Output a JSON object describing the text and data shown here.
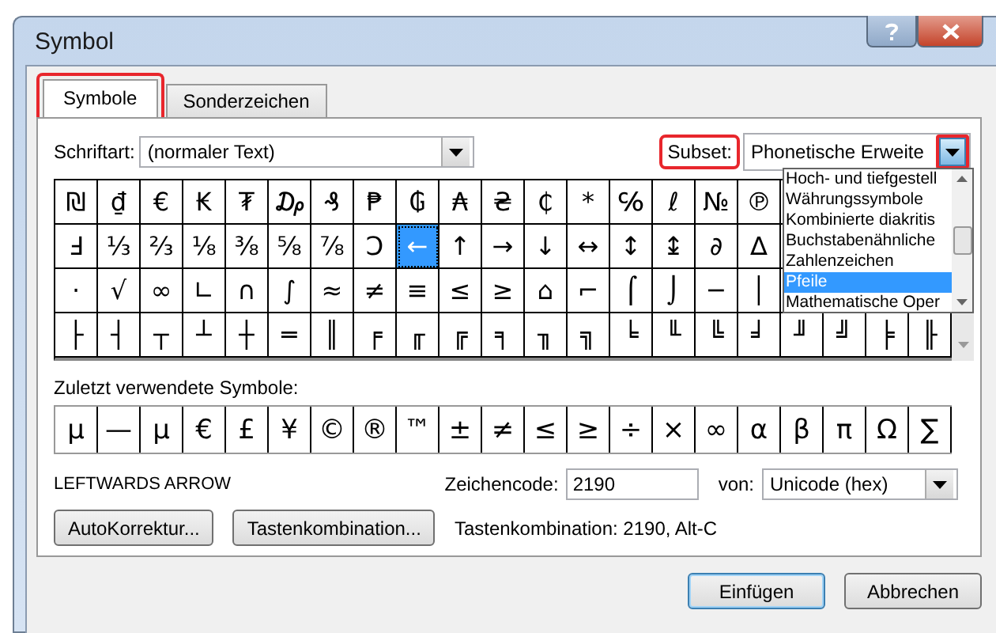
{
  "window": {
    "title": "Symbol"
  },
  "tabs": [
    {
      "label": "Symbole",
      "selected": true,
      "highlighted": true
    },
    {
      "label": "Sonderzeichen",
      "selected": false,
      "highlighted": false
    }
  ],
  "font": {
    "label": "Schriftart:",
    "value": "(normaler Text)"
  },
  "subset": {
    "label": "Subset:",
    "label_highlighted": true,
    "value": "Phonetische Erweite",
    "arrow_highlighted": true,
    "expanded": true,
    "options": [
      {
        "label": "Hoch- und tiefgestell",
        "selected": false
      },
      {
        "label": "Währungssymbole",
        "selected": false
      },
      {
        "label": "Kombinierte diakritis",
        "selected": false
      },
      {
        "label": "Buchstabenähnliche",
        "selected": false
      },
      {
        "label": "Zahlenzeichen",
        "selected": false
      },
      {
        "label": "Pfeile",
        "selected": true
      },
      {
        "label": "Mathematische Oper",
        "selected": false
      }
    ]
  },
  "symbol_grid": {
    "rows": [
      [
        {
          "symbol": "₪",
          "selected": false
        },
        {
          "symbol": "₫",
          "selected": false
        },
        {
          "symbol": "€",
          "selected": false
        },
        {
          "symbol": "₭",
          "selected": false
        },
        {
          "symbol": "₮",
          "selected": false
        },
        {
          "symbol": "₯",
          "selected": false
        },
        {
          "symbol": "₰",
          "selected": false
        },
        {
          "symbol": "₱",
          "selected": false
        },
        {
          "symbol": "₲",
          "selected": false
        },
        {
          "symbol": "₳",
          "selected": false
        },
        {
          "symbol": "₴",
          "selected": false
        },
        {
          "symbol": "₵",
          "selected": false
        },
        {
          "symbol": "*",
          "selected": false
        },
        {
          "symbol": "℅",
          "selected": false
        },
        {
          "symbol": "ℓ",
          "selected": false
        },
        {
          "symbol": "№",
          "selected": false
        },
        {
          "symbol": "℗",
          "selected": false
        }
      ],
      [
        {
          "symbol": "Ⅎ",
          "selected": false
        },
        {
          "symbol": "⅓",
          "selected": false
        },
        {
          "symbol": "⅔",
          "selected": false
        },
        {
          "symbol": "⅛",
          "selected": false
        },
        {
          "symbol": "⅜",
          "selected": false
        },
        {
          "symbol": "⅝",
          "selected": false
        },
        {
          "symbol": "⅞",
          "selected": false
        },
        {
          "symbol": "Ↄ",
          "selected": false
        },
        {
          "symbol": "←",
          "selected": true
        },
        {
          "symbol": "↑",
          "selected": false
        },
        {
          "symbol": "→",
          "selected": false
        },
        {
          "symbol": "↓",
          "selected": false
        },
        {
          "symbol": "↔",
          "selected": false
        },
        {
          "symbol": "↕",
          "selected": false
        },
        {
          "symbol": "↨",
          "selected": false
        },
        {
          "symbol": "∂",
          "selected": false
        },
        {
          "symbol": "∆",
          "selected": false
        }
      ],
      [
        {
          "symbol": "·",
          "selected": false
        },
        {
          "symbol": "√",
          "selected": false
        },
        {
          "symbol": "∞",
          "selected": false
        },
        {
          "symbol": "∟",
          "selected": false
        },
        {
          "symbol": "∩",
          "selected": false
        },
        {
          "symbol": "∫",
          "selected": false
        },
        {
          "symbol": "≈",
          "selected": false
        },
        {
          "symbol": "≠",
          "selected": false
        },
        {
          "symbol": "≡",
          "selected": false
        },
        {
          "symbol": "≤",
          "selected": false
        },
        {
          "symbol": "≥",
          "selected": false
        },
        {
          "symbol": "⌂",
          "selected": false
        },
        {
          "symbol": "⌐",
          "selected": false
        },
        {
          "symbol": "⌠",
          "selected": false
        },
        {
          "symbol": "⌡",
          "selected": false
        },
        {
          "symbol": "─",
          "selected": false
        },
        {
          "symbol": "│",
          "selected": false
        }
      ],
      [
        {
          "symbol": "├",
          "selected": false
        },
        {
          "symbol": "┤",
          "selected": false
        },
        {
          "symbol": "┬",
          "selected": false
        },
        {
          "symbol": "┴",
          "selected": false
        },
        {
          "symbol": "┼",
          "selected": false
        },
        {
          "symbol": "═",
          "selected": false
        },
        {
          "symbol": "║",
          "selected": false
        },
        {
          "symbol": "╒",
          "selected": false
        },
        {
          "symbol": "╓",
          "selected": false
        },
        {
          "symbol": "╔",
          "selected": false
        },
        {
          "symbol": "╕",
          "selected": false
        },
        {
          "symbol": "╖",
          "selected": false
        },
        {
          "symbol": "╗",
          "selected": false
        },
        {
          "symbol": "╘",
          "selected": false
        },
        {
          "symbol": "╙",
          "selected": false
        },
        {
          "symbol": "╚",
          "selected": false
        },
        {
          "symbol": "╛",
          "selected": false
        },
        {
          "symbol": "╜",
          "selected": false
        },
        {
          "symbol": "╝",
          "selected": false
        },
        {
          "symbol": "╞",
          "selected": false
        },
        {
          "symbol": "╟",
          "selected": false
        }
      ]
    ]
  },
  "recent": {
    "label": "Zuletzt verwendete Symbole:",
    "symbols": [
      "µ",
      "—",
      "μ",
      "€",
      "£",
      "¥",
      "©",
      "®",
      "™",
      "±",
      "≠",
      "≤",
      "≥",
      "÷",
      "×",
      "∞",
      "α",
      "β",
      "π",
      "Ω",
      "∑"
    ]
  },
  "character_name": "LEFTWARDS ARROW",
  "character_code": {
    "label": "Zeichencode:",
    "value": "2190"
  },
  "code_from": {
    "label": "von:",
    "value": "Unicode (hex)"
  },
  "buttons": [
    "AutoKorrektur...",
    "Tastenkombination..."
  ],
  "shortcut_text": "Tastenkombination: 2190, Alt-C",
  "footer_buttons": [
    {
      "label": "Einfügen",
      "default": true
    },
    {
      "label": "Abbrechen",
      "default": false
    }
  ]
}
